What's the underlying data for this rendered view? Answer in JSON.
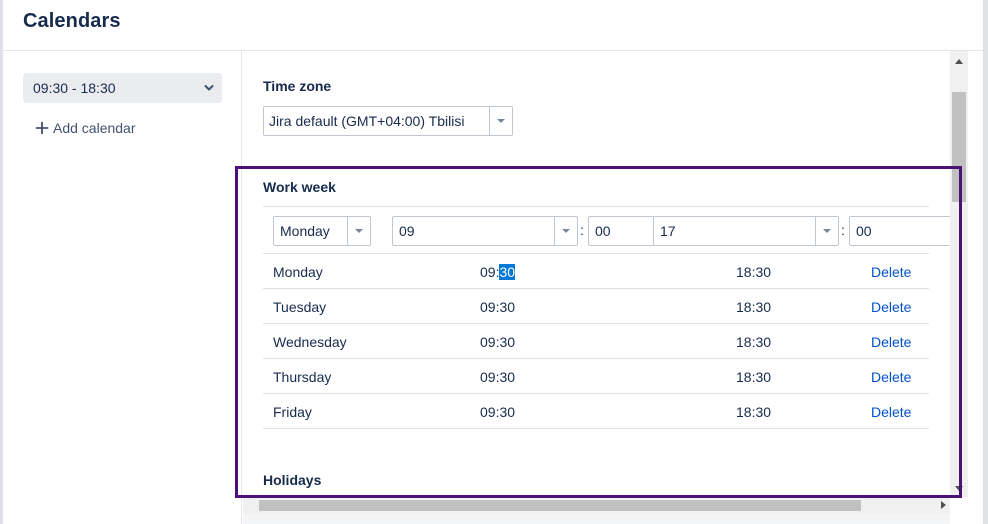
{
  "dialog": {
    "title": "Calendars"
  },
  "sidebar": {
    "selected_calendar": "09:30 - 18:30",
    "add_calendar_label": "Add calendar"
  },
  "time_zone": {
    "heading": "Time zone",
    "value": "Jira default (GMT+04:00) Tbilisi"
  },
  "work_week": {
    "heading": "Work week",
    "new_entry": {
      "day": "Monday",
      "start_hour": "09",
      "start_minute": "00",
      "end_hour": "17",
      "end_minute": "00",
      "separator": ":"
    },
    "rows": [
      {
        "day": "Monday",
        "start": "09:30",
        "start_prefix": "09:",
        "start_selected": "30",
        "end": "18:30",
        "action": "Delete"
      },
      {
        "day": "Tuesday",
        "start": "09:30",
        "end": "18:30",
        "action": "Delete"
      },
      {
        "day": "Wednesday",
        "start": "09:30",
        "end": "18:30",
        "action": "Delete"
      },
      {
        "day": "Thursday",
        "start": "09:30",
        "end": "18:30",
        "action": "Delete"
      },
      {
        "day": "Friday",
        "start": "09:30",
        "end": "18:30",
        "action": "Delete"
      }
    ]
  },
  "holidays": {
    "heading": "Holidays"
  },
  "icons": {
    "chevron": "chevron-down-icon",
    "add": "plus-icon",
    "dropdown": "caret-down-icon"
  },
  "colors": {
    "link": "#0052cc",
    "highlight_box": "#4b1178",
    "text_selection": "#0078d7"
  }
}
